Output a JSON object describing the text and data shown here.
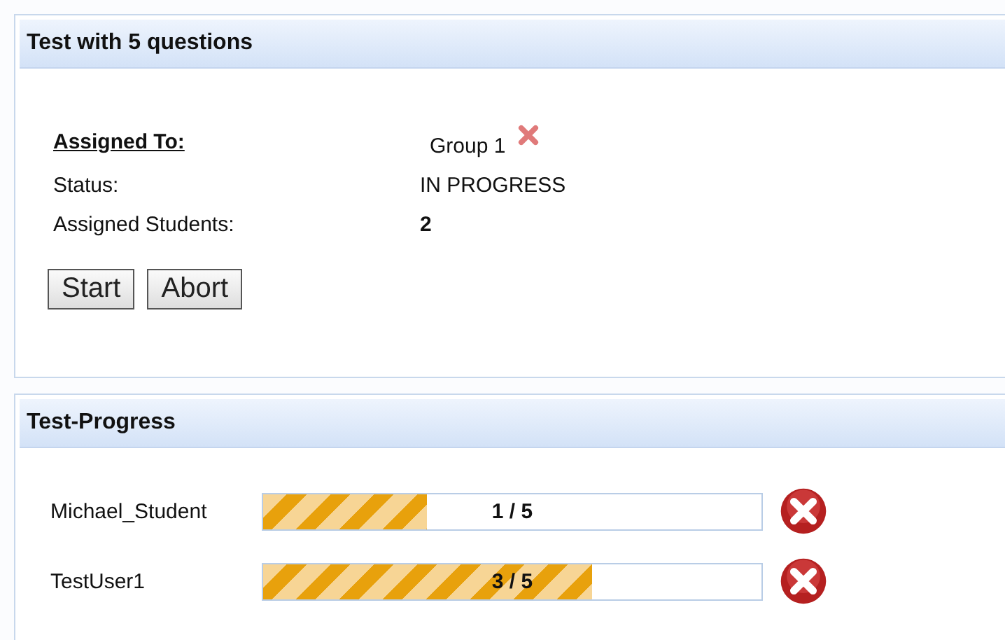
{
  "test_panel": {
    "title": "Test with 5 questions",
    "assigned_to": {
      "label": "Assigned To:",
      "value": "Group 1"
    },
    "fields": [
      {
        "label": "Status:",
        "value": "IN PROGRESS",
        "bold": false
      },
      {
        "label": "Assigned Students:",
        "value": "2",
        "bold": true
      }
    ],
    "buttons": [
      "Start",
      "Abort"
    ]
  },
  "progress_panel": {
    "title": "Test-Progress",
    "students": [
      {
        "name": "Michael_Student",
        "level": 0.33,
        "reading": "1 / 5"
      },
      {
        "name": "TestUser1",
        "level": 0.66,
        "reading": "3 / 5"
      }
    ]
  }
}
